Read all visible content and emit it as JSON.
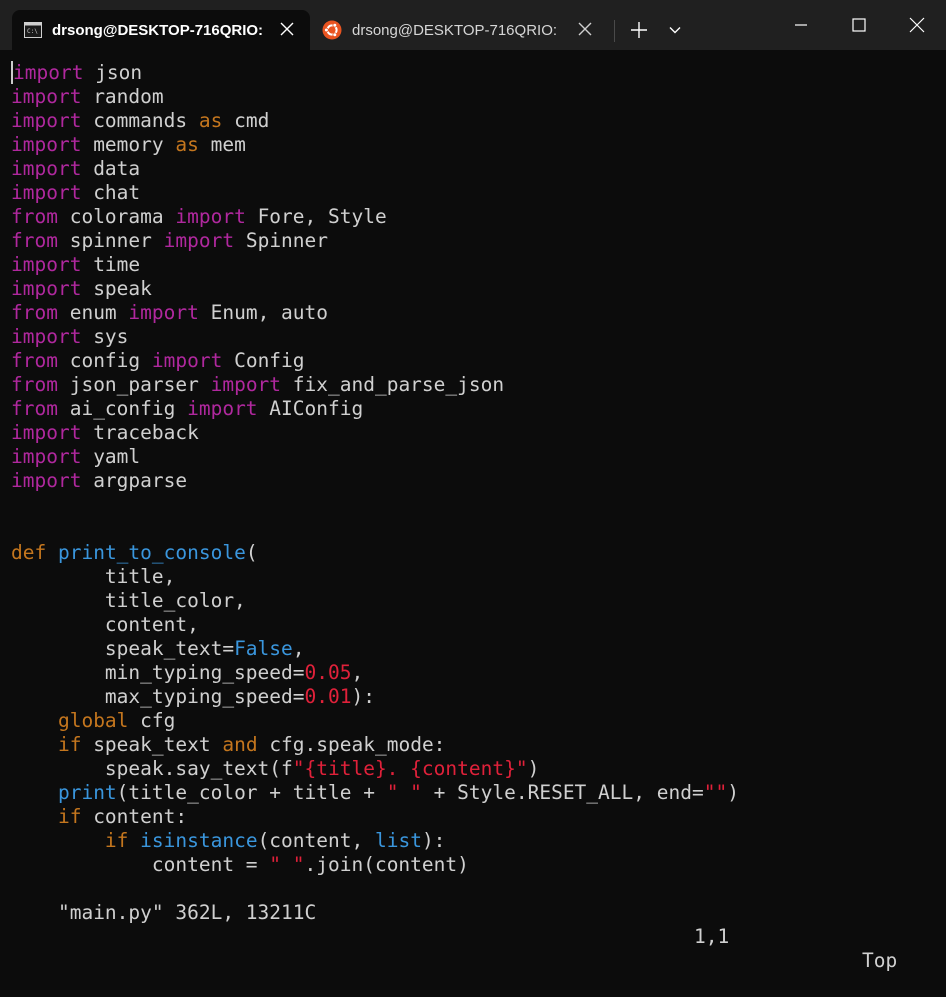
{
  "window": {
    "tabs": [
      {
        "title": "drsong@DESKTOP-716QRIO:",
        "active": true,
        "icon": "cmd-icon"
      },
      {
        "title": "drsong@DESKTOP-716QRIO: ~",
        "active": false,
        "icon": "ubuntu-icon"
      }
    ],
    "buttons": [
      "close-tab",
      "new-tab",
      "dropdown",
      "minimize",
      "maximize",
      "close-window"
    ]
  },
  "colors": {
    "background": "#0c0c0c",
    "titlebar": "#202020",
    "keyword_purple": "#b0289e",
    "keyword_orange": "#c4761e",
    "function_blue": "#3a96dd",
    "literal_red": "#e0213a",
    "text": "#d0d0d0",
    "ubuntu_orange": "#e95420"
  },
  "code": [
    [
      [
        "kw",
        "import"
      ],
      [
        "t",
        " json"
      ]
    ],
    [
      [
        "kw",
        "import"
      ],
      [
        "t",
        " random"
      ]
    ],
    [
      [
        "kw",
        "import"
      ],
      [
        "t",
        " commands "
      ],
      [
        "kw2",
        "as"
      ],
      [
        "t",
        " cmd"
      ]
    ],
    [
      [
        "kw",
        "import"
      ],
      [
        "t",
        " memory "
      ],
      [
        "kw2",
        "as"
      ],
      [
        "t",
        " mem"
      ]
    ],
    [
      [
        "kw",
        "import"
      ],
      [
        "t",
        " data"
      ]
    ],
    [
      [
        "kw",
        "import"
      ],
      [
        "t",
        " chat"
      ]
    ],
    [
      [
        "kw",
        "from"
      ],
      [
        "t",
        " colorama "
      ],
      [
        "kw",
        "import"
      ],
      [
        "t",
        " Fore, Style"
      ]
    ],
    [
      [
        "kw",
        "from"
      ],
      [
        "t",
        " spinner "
      ],
      [
        "kw",
        "import"
      ],
      [
        "t",
        " Spinner"
      ]
    ],
    [
      [
        "kw",
        "import"
      ],
      [
        "t",
        " time"
      ]
    ],
    [
      [
        "kw",
        "import"
      ],
      [
        "t",
        " speak"
      ]
    ],
    [
      [
        "kw",
        "from"
      ],
      [
        "t",
        " enum "
      ],
      [
        "kw",
        "import"
      ],
      [
        "t",
        " Enum, auto"
      ]
    ],
    [
      [
        "kw",
        "import"
      ],
      [
        "t",
        " sys"
      ]
    ],
    [
      [
        "kw",
        "from"
      ],
      [
        "t",
        " config "
      ],
      [
        "kw",
        "import"
      ],
      [
        "t",
        " Config"
      ]
    ],
    [
      [
        "kw",
        "from"
      ],
      [
        "t",
        " json_parser "
      ],
      [
        "kw",
        "import"
      ],
      [
        "t",
        " fix_and_parse_json"
      ]
    ],
    [
      [
        "kw",
        "from"
      ],
      [
        "t",
        " ai_config "
      ],
      [
        "kw",
        "import"
      ],
      [
        "t",
        " AIConfig"
      ]
    ],
    [
      [
        "kw",
        "import"
      ],
      [
        "t",
        " traceback"
      ]
    ],
    [
      [
        "kw",
        "import"
      ],
      [
        "t",
        " yaml"
      ]
    ],
    [
      [
        "kw",
        "import"
      ],
      [
        "t",
        " argparse"
      ]
    ],
    [],
    [],
    [
      [
        "kw2",
        "def"
      ],
      [
        "t",
        " "
      ],
      [
        "fn",
        "print_to_console"
      ],
      [
        "t",
        "("
      ]
    ],
    [
      [
        "t",
        "        title,"
      ]
    ],
    [
      [
        "t",
        "        title_color,"
      ]
    ],
    [
      [
        "t",
        "        content,"
      ]
    ],
    [
      [
        "t",
        "        speak_text="
      ],
      [
        "fn",
        "False"
      ],
      [
        "t",
        ","
      ]
    ],
    [
      [
        "t",
        "        min_typing_speed="
      ],
      [
        "num",
        "0.05"
      ],
      [
        "t",
        ","
      ]
    ],
    [
      [
        "t",
        "        max_typing_speed="
      ],
      [
        "num",
        "0.01"
      ],
      [
        "t",
        "):"
      ]
    ],
    [
      [
        "t",
        "    "
      ],
      [
        "kw2",
        "global"
      ],
      [
        "t",
        " cfg"
      ]
    ],
    [
      [
        "t",
        "    "
      ],
      [
        "kw2",
        "if"
      ],
      [
        "t",
        " speak_text "
      ],
      [
        "kw2",
        "and"
      ],
      [
        "t",
        " cfg.speak_mode:"
      ]
    ],
    [
      [
        "t",
        "        speak.say_text(f"
      ],
      [
        "str",
        "\"{title}. {content}\""
      ],
      [
        "t",
        ")"
      ]
    ],
    [
      [
        "t",
        "    "
      ],
      [
        "fn",
        "print"
      ],
      [
        "t",
        "(title_color + title + "
      ],
      [
        "str",
        "\" \""
      ],
      [
        "t",
        " + Style.RESET_ALL, end="
      ],
      [
        "str",
        "\"\""
      ],
      [
        "t",
        ")"
      ]
    ],
    [
      [
        "t",
        "    "
      ],
      [
        "kw2",
        "if"
      ],
      [
        "t",
        " content:"
      ]
    ],
    [
      [
        "t",
        "        "
      ],
      [
        "kw2",
        "if"
      ],
      [
        "t",
        " "
      ],
      [
        "fn",
        "isinstance"
      ],
      [
        "t",
        "(content, "
      ],
      [
        "fn",
        "list"
      ],
      [
        "t",
        "):"
      ]
    ],
    [
      [
        "t",
        "            content = "
      ],
      [
        "str",
        "\" \""
      ],
      [
        "t",
        ".join(content)"
      ]
    ]
  ],
  "status": {
    "file": "\"main.py\" 362L, 13211C",
    "position": "1,1",
    "scroll": "Top"
  }
}
